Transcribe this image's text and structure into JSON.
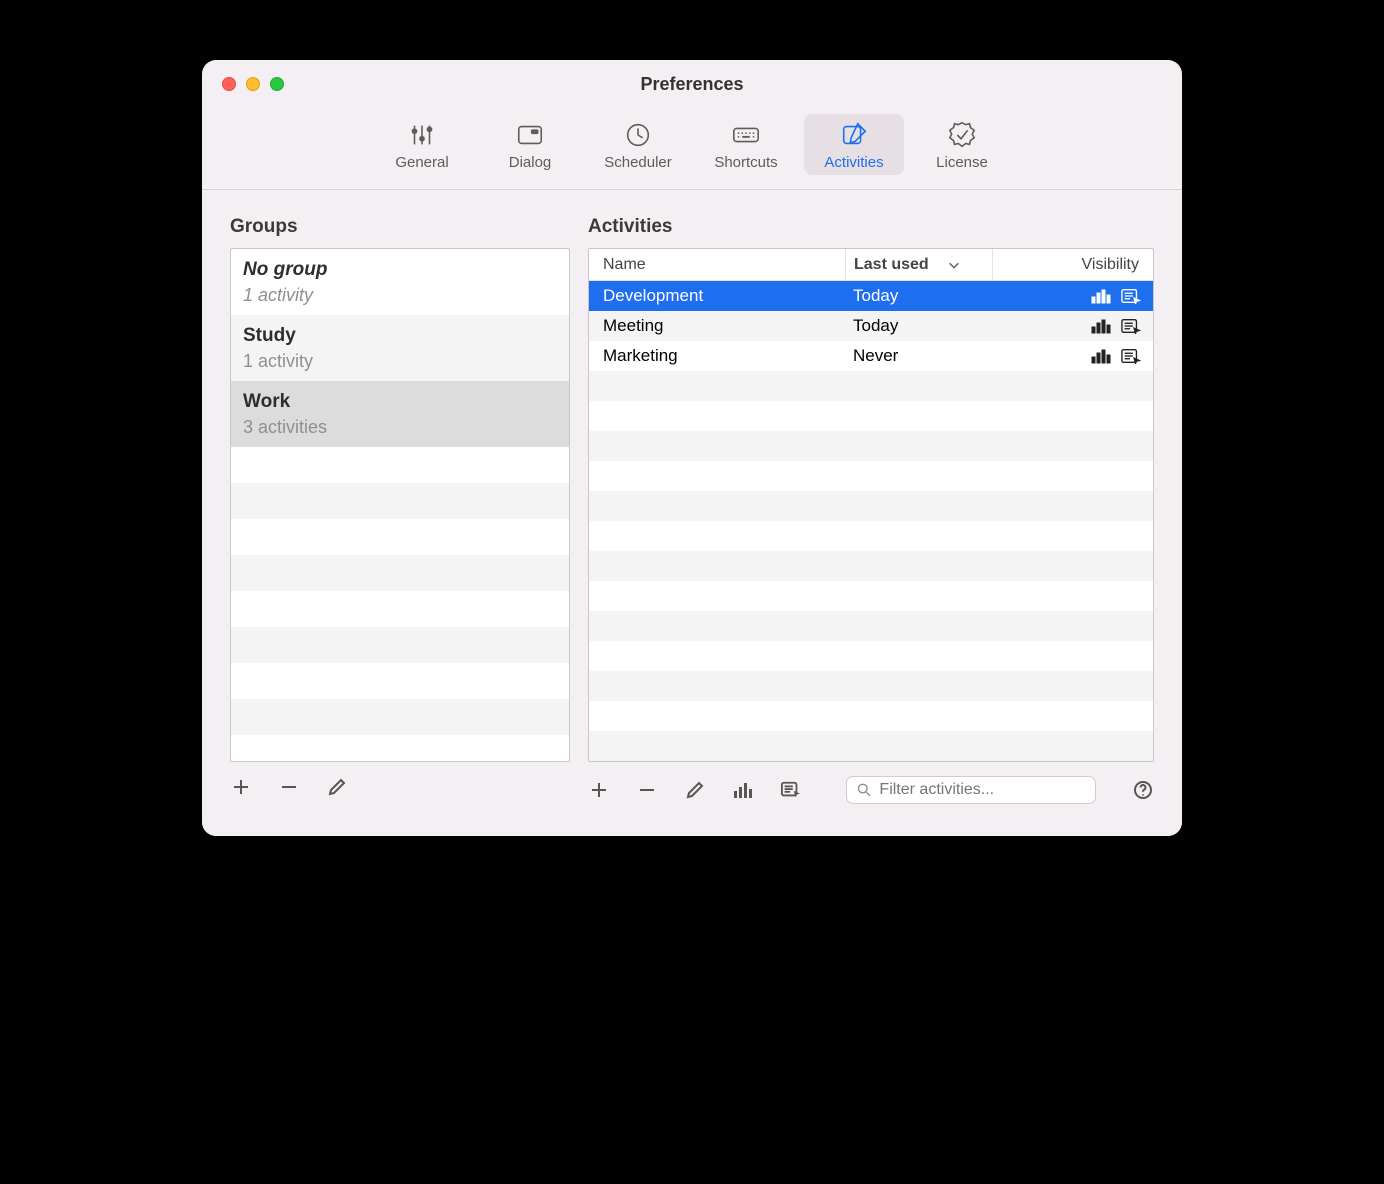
{
  "window": {
    "title": "Preferences"
  },
  "toolbar": {
    "items": [
      {
        "label": "General"
      },
      {
        "label": "Dialog"
      },
      {
        "label": "Scheduler"
      },
      {
        "label": "Shortcuts"
      },
      {
        "label": "Activities",
        "selected": true
      },
      {
        "label": "License"
      }
    ]
  },
  "groups": {
    "title": "Groups",
    "items": [
      {
        "title": "No group",
        "subtitle": "1 activity",
        "style": "italic"
      },
      {
        "title": "Study",
        "subtitle": "1 activity"
      },
      {
        "title": "Work",
        "subtitle": "3 activities",
        "selected": true
      }
    ]
  },
  "activities": {
    "title": "Activities",
    "columns": {
      "name": "Name",
      "last_used": "Last used",
      "visibility": "Visibility"
    },
    "rows": [
      {
        "name": "Development",
        "last_used": "Today",
        "selected": true
      },
      {
        "name": "Meeting",
        "last_used": "Today"
      },
      {
        "name": "Marketing",
        "last_used": "Never"
      }
    ],
    "filter_placeholder": "Filter activities..."
  }
}
